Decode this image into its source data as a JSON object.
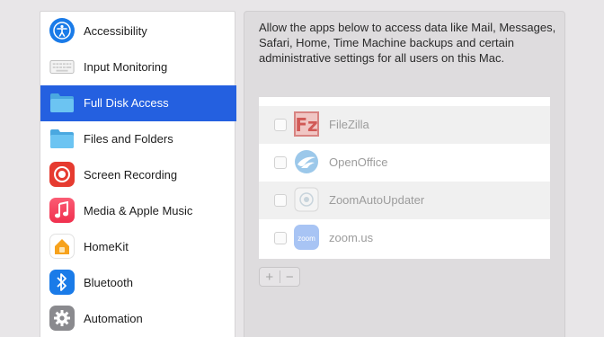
{
  "sidebar": {
    "selected_index": 2,
    "items": [
      {
        "label": "Accessibility",
        "icon": "accessibility-icon",
        "color": "#1a7be8"
      },
      {
        "label": "Input Monitoring",
        "icon": "keyboard-icon",
        "color": "#d8d8d8"
      },
      {
        "label": "Full Disk Access",
        "icon": "folder-icon",
        "color": "#5ab8ec"
      },
      {
        "label": "Files and Folders",
        "icon": "folder-icon",
        "color": "#5ab8ec"
      },
      {
        "label": "Screen Recording",
        "icon": "record-icon",
        "color": "#e63b30"
      },
      {
        "label": "Media & Apple Music",
        "icon": "music-note-icon",
        "color": "#f03e5c"
      },
      {
        "label": "HomeKit",
        "icon": "home-icon",
        "color": "#ffffff"
      },
      {
        "label": "Bluetooth",
        "icon": "bluetooth-icon",
        "color": "#1a7be8"
      },
      {
        "label": "Automation",
        "icon": "gear-icon",
        "color": "#8a8a8e"
      }
    ]
  },
  "main": {
    "description": "Allow the apps below to access data like Mail, Messages, Safari, Home, Time Machine backups and certain administrative settings for all users on this Mac.",
    "apps": [
      {
        "name": "FileZilla",
        "icon": "filezilla-icon",
        "checked": false
      },
      {
        "name": "OpenOffice",
        "icon": "openoffice-icon",
        "checked": false
      },
      {
        "name": "ZoomAutoUpdater",
        "icon": "zoom-updater-icon",
        "checked": false
      },
      {
        "name": "zoom.us",
        "icon": "zoom-icon",
        "icon_text": "zoom",
        "checked": false
      }
    ],
    "add_label": "+",
    "remove_label": "−"
  }
}
